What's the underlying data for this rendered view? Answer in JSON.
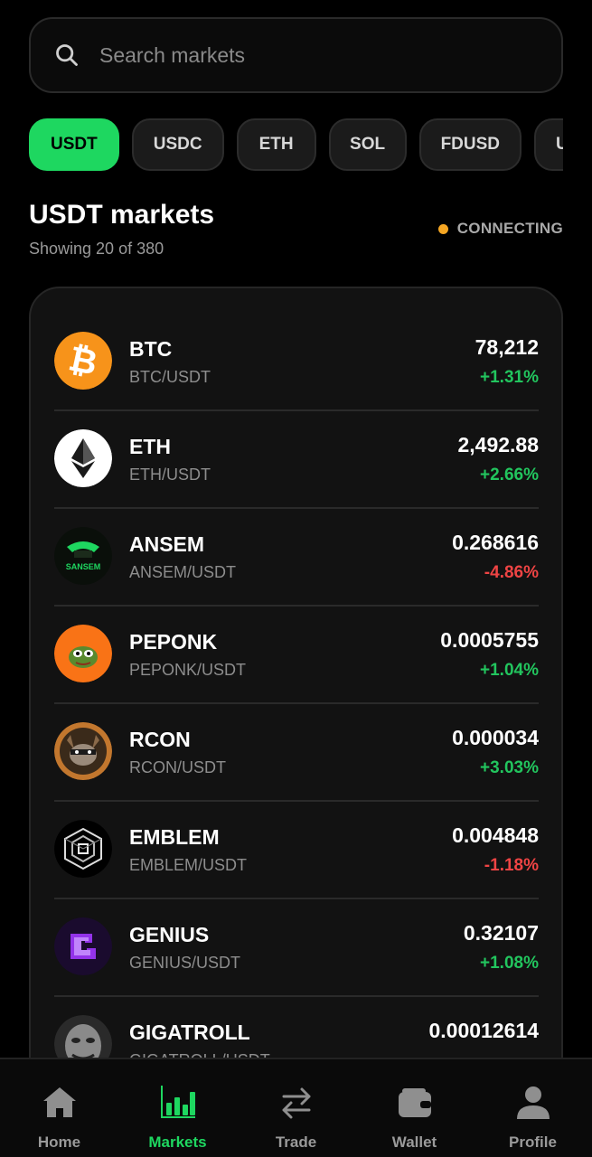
{
  "search": {
    "placeholder": "Search markets"
  },
  "chips": [
    "USDT",
    "USDC",
    "ETH",
    "SOL",
    "FDUSD",
    "US"
  ],
  "chips_active": "USDT",
  "header": {
    "title": "USDT markets",
    "subtitle": "Showing 20 of 380",
    "status": "CONNECTING",
    "status_color": "#f5a623"
  },
  "markets": [
    {
      "symbol": "BTC",
      "pair": "BTC/USDT",
      "price": "78,212",
      "change": "+1.31%",
      "direction": "up",
      "icon": "btc-logo"
    },
    {
      "symbol": "ETH",
      "pair": "ETH/USDT",
      "price": "2,492.88",
      "change": "+2.66%",
      "direction": "up",
      "icon": "eth-logo"
    },
    {
      "symbol": "ANSEM",
      "pair": "ANSEM/USDT",
      "price": "0.268616",
      "change": "-4.86%",
      "direction": "down",
      "icon": "ansem-logo"
    },
    {
      "symbol": "PEPONK",
      "pair": "PEPONK/USDT",
      "price": "0.0005755",
      "change": "+1.04%",
      "direction": "up",
      "icon": "peponk-logo"
    },
    {
      "symbol": "RCON",
      "pair": "RCON/USDT",
      "price": "0.000034",
      "change": "+3.03%",
      "direction": "up",
      "icon": "rcon-logo"
    },
    {
      "symbol": "EMBLEM",
      "pair": "EMBLEM/USDT",
      "price": "0.004848",
      "change": "-1.18%",
      "direction": "down",
      "icon": "emblem-logo"
    },
    {
      "symbol": "GENIUS",
      "pair": "GENIUS/USDT",
      "price": "0.32107",
      "change": "+1.08%",
      "direction": "up",
      "icon": "genius-logo"
    },
    {
      "symbol": "GIGATROLL",
      "pair": "GIGATROLL/USDT",
      "price": "0.00012614",
      "change": "",
      "direction": "up",
      "icon": "gigatroll-logo"
    }
  ],
  "tabbar": [
    {
      "label": "Home",
      "icon": "home-icon",
      "active": false
    },
    {
      "label": "Markets",
      "icon": "markets-icon",
      "active": true
    },
    {
      "label": "Trade",
      "icon": "trade-icon",
      "active": false
    },
    {
      "label": "Wallet",
      "icon": "wallet-icon",
      "active": false
    },
    {
      "label": "Profile",
      "icon": "profile-icon",
      "active": false
    }
  ],
  "colors": {
    "accent": "#1ed760",
    "positive": "#22c55e",
    "negative": "#ef4444"
  }
}
